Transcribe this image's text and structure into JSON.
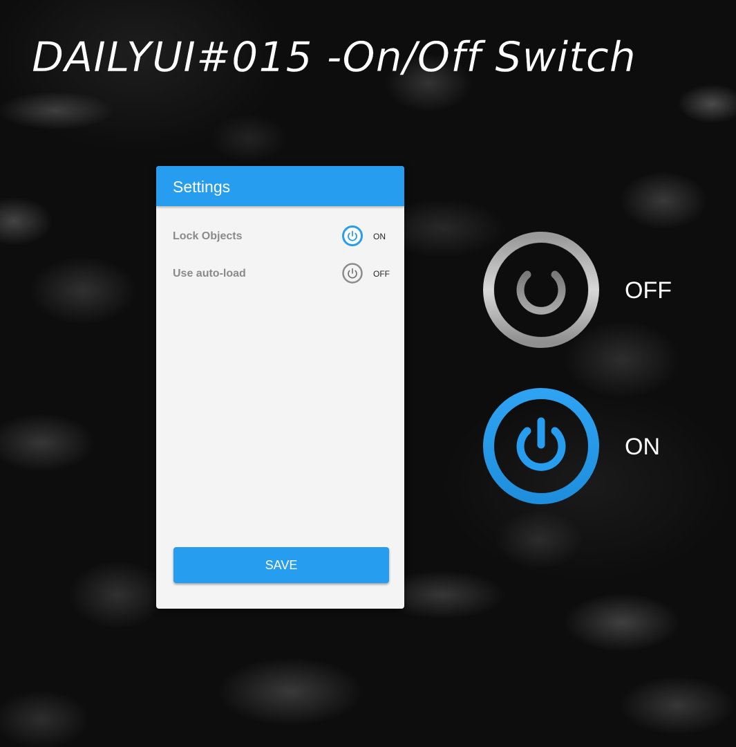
{
  "page": {
    "title": "DAILYUI#015 -On/Off Switch"
  },
  "settings": {
    "title": "Settings",
    "items": [
      {
        "label": "Lock Objects",
        "state": "ON",
        "icon": "power-icon"
      },
      {
        "label": "Use auto-load",
        "state": "OFF",
        "icon": "power-icon"
      }
    ],
    "save_label": "SAVE"
  },
  "showcase": {
    "off_label": "OFF",
    "on_label": "ON"
  },
  "colors": {
    "accent": "#279def",
    "off_gray": "#8c8c8c",
    "panel_bg": "#f4f4f4"
  }
}
